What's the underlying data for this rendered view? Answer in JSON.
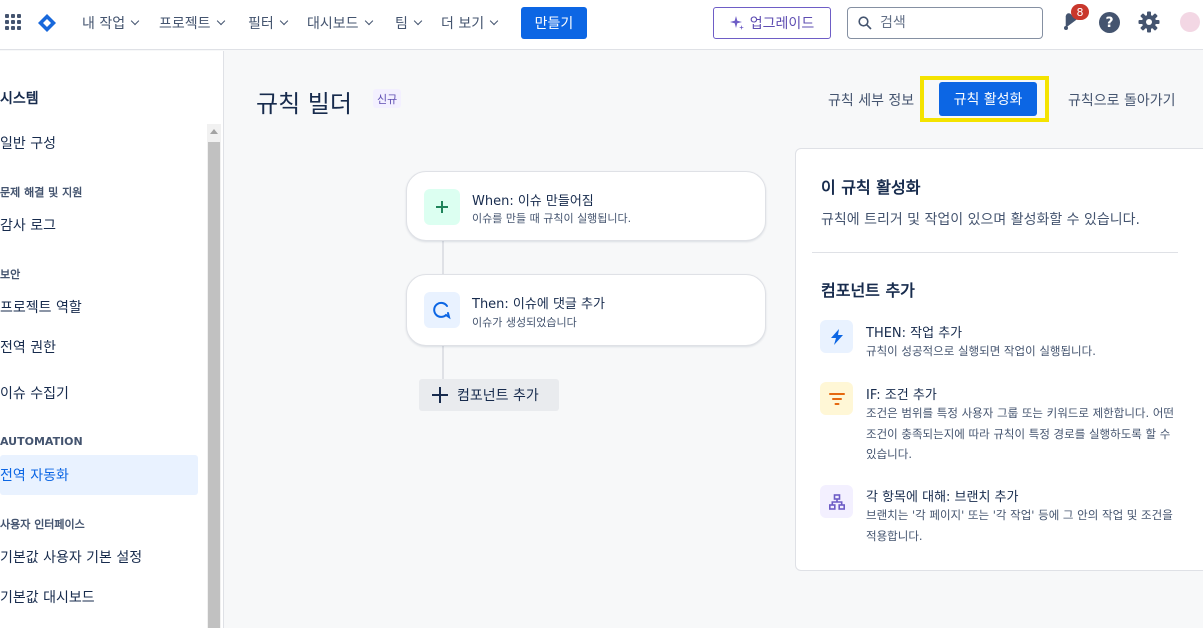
{
  "topnav": {
    "items": [
      {
        "label": "내 작업"
      },
      {
        "label": "프로젝트"
      },
      {
        "label": "필터"
      },
      {
        "label": "대시보드"
      },
      {
        "label": "팀"
      },
      {
        "label": "더 보기"
      }
    ],
    "create_label": "만들기",
    "upgrade_label": "업그레이드",
    "search_placeholder": "검색",
    "notification_count": "8",
    "help_glyph": "?"
  },
  "sidebar": {
    "title": "시스템",
    "general": "일반 구성",
    "sections": [
      {
        "heading": "문제 해결 및 지원",
        "items": [
          "감사 로그"
        ]
      },
      {
        "heading": "보안",
        "items": [
          "프로젝트 역할",
          "전역 권한",
          "이슈 수집기"
        ]
      },
      {
        "heading": "AUTOMATION",
        "items": [
          "전역 자동화"
        ]
      },
      {
        "heading": "사용자 인터페이스",
        "items": [
          "기본값 사용자 기본 설정",
          "기본값 대시보드"
        ]
      }
    ]
  },
  "header": {
    "title": "규칙 빌더",
    "lozenge": "신규",
    "details_link": "규칙 세부 정보",
    "activate_label": "규칙 활성화",
    "back_link": "규칙으로 돌아가기"
  },
  "flow": {
    "trigger_title": "When: 이슈 만들어짐",
    "trigger_desc": "이슈를 만들 때 규칙이 실행됩니다.",
    "action_title": "Then: 이슈에 댓글 추가",
    "action_desc": "이슈가 생성되었습니다",
    "add_component_label": "컴포넌트 추가"
  },
  "panel": {
    "heading": "이 규칙 활성화",
    "description": "규칙에 트리거 및 작업이 있으며 활성화할 수 있습니다.",
    "add_heading": "컴포넌트 추가",
    "options": [
      {
        "title": "THEN: 작업 추가",
        "desc": "규칙이 성공적으로 실행되면 작업이 실행됩니다."
      },
      {
        "title": "IF: 조건 추가",
        "desc": "조건은 범위를 특정 사용자 그룹 또는 키워드로 제한합니다. 어떤 조건이 충족되는지에 따라 규칙이 특정 경로를 실행하도록 할 수 있습니다."
      },
      {
        "title": "각 항목에 대해: 브랜치 추가",
        "desc": "브랜치는 '각 페이지' 또는 '각 작업' 등에 그 안의 작업 및 조건을 적용합니다."
      }
    ]
  },
  "colors": {
    "brand_blue": "#0c66e4",
    "highlight_yellow": "#f4e300",
    "upgrade_purple": "#5e4db2",
    "badge_red": "#c9372c"
  },
  "icons": {
    "apps": "grid-icon",
    "logo": "jira-logo",
    "upgrade": "sparkle-icon",
    "search": "search-icon",
    "notifications": "bell-icon",
    "help": "help-icon",
    "settings": "gear-icon",
    "trigger": "plus-icon",
    "action": "comment-icon",
    "add": "plus-icon",
    "then": "lightning-icon",
    "if": "filter-icon",
    "branch": "branch-icon"
  }
}
